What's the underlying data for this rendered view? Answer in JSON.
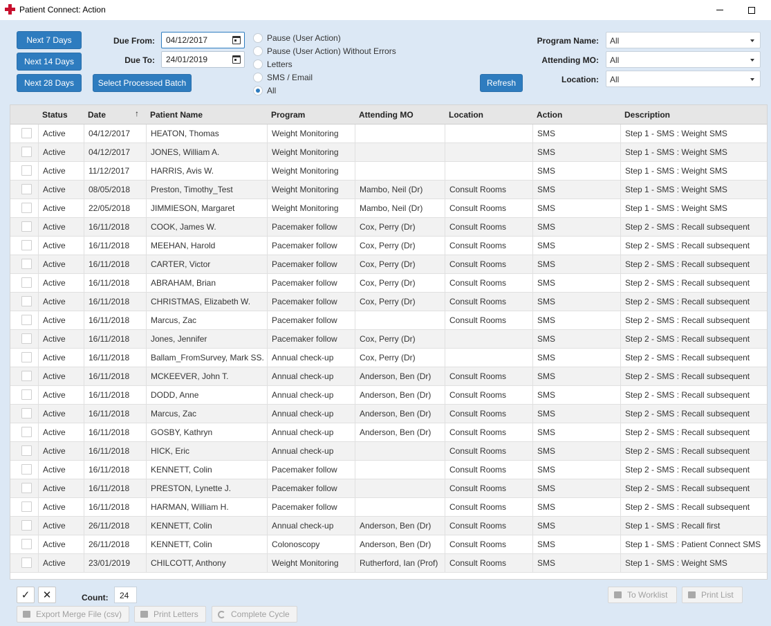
{
  "window": {
    "title": "Patient Connect: Action"
  },
  "buttons": {
    "next7": "Next 7 Days",
    "next14": "Next 14 Days",
    "next28": "Next 28 Days",
    "select_batch": "Select Processed Batch",
    "refresh": "Refresh"
  },
  "filters": {
    "due_from_label": "Due From:",
    "due_from_value": "04/12/2017",
    "due_to_label": "Due To:",
    "due_to_value": "24/01/2019",
    "radio_options": [
      {
        "label": "Pause (User Action)",
        "checked": false
      },
      {
        "label": "Pause (User Action) Without Errors",
        "checked": false
      },
      {
        "label": "Letters",
        "checked": false
      },
      {
        "label": "SMS / Email",
        "checked": false
      },
      {
        "label": "All",
        "checked": true
      }
    ],
    "program_label": "Program Name:",
    "program_value": "All",
    "mo_label": "Attending MO:",
    "mo_value": "All",
    "location_label": "Location:",
    "location_value": "All"
  },
  "table": {
    "columns": [
      "Status",
      "Date",
      "Patient Name",
      "Program",
      "Attending MO",
      "Location",
      "Action",
      "Description"
    ],
    "sort_indicator": "↑",
    "rows": [
      [
        "Active",
        "04/12/2017",
        "HEATON, Thomas",
        "Weight Monitoring",
        "",
        "",
        "SMS",
        "Step 1 - SMS : Weight SMS"
      ],
      [
        "Active",
        "04/12/2017",
        "JONES, William A.",
        "Weight Monitoring",
        "",
        "",
        "SMS",
        "Step 1 - SMS : Weight SMS"
      ],
      [
        "Active",
        "11/12/2017",
        "HARRIS, Avis W.",
        "Weight Monitoring",
        "",
        "",
        "SMS",
        "Step 1 - SMS : Weight SMS"
      ],
      [
        "Active",
        "08/05/2018",
        "Preston, Timothy_Test",
        "Weight Monitoring",
        "Mambo, Neil (Dr)",
        "Consult Rooms",
        "SMS",
        "Step 1 - SMS : Weight SMS"
      ],
      [
        "Active",
        "22/05/2018",
        "JIMMIESON, Margaret",
        "Weight Monitoring",
        "Mambo, Neil (Dr)",
        "Consult Rooms",
        "SMS",
        "Step 1 - SMS : Weight SMS"
      ],
      [
        "Active",
        "16/11/2018",
        "COOK, James W.",
        "Pacemaker follow",
        "Cox, Perry (Dr)",
        "Consult Rooms",
        "SMS",
        "Step 2 - SMS : Recall subsequent"
      ],
      [
        "Active",
        "16/11/2018",
        "MEEHAN, Harold",
        "Pacemaker follow",
        "Cox, Perry (Dr)",
        "Consult Rooms",
        "SMS",
        "Step 2 - SMS : Recall subsequent"
      ],
      [
        "Active",
        "16/11/2018",
        "CARTER, Victor",
        "Pacemaker follow",
        "Cox, Perry (Dr)",
        "Consult Rooms",
        "SMS",
        "Step 2 - SMS : Recall subsequent"
      ],
      [
        "Active",
        "16/11/2018",
        "ABRAHAM, Brian",
        "Pacemaker follow",
        "Cox, Perry (Dr)",
        "Consult Rooms",
        "SMS",
        "Step 2 - SMS : Recall subsequent"
      ],
      [
        "Active",
        "16/11/2018",
        "CHRISTMAS, Elizabeth W.",
        "Pacemaker follow",
        "Cox, Perry (Dr)",
        "Consult Rooms",
        "SMS",
        "Step 2 - SMS : Recall subsequent"
      ],
      [
        "Active",
        "16/11/2018",
        "Marcus, Zac",
        "Pacemaker follow",
        "",
        "Consult Rooms",
        "SMS",
        "Step 2 - SMS : Recall subsequent"
      ],
      [
        "Active",
        "16/11/2018",
        "Jones, Jennifer",
        "Pacemaker follow",
        "Cox, Perry (Dr)",
        "",
        "SMS",
        "Step 2 - SMS : Recall subsequent"
      ],
      [
        "Active",
        "16/11/2018",
        "Ballam_FromSurvey, Mark SS.",
        "Annual check-up",
        "Cox, Perry (Dr)",
        "",
        "SMS",
        "Step 2 - SMS : Recall subsequent"
      ],
      [
        "Active",
        "16/11/2018",
        "MCKEEVER, John T.",
        "Annual check-up",
        "Anderson, Ben (Dr)",
        "Consult Rooms",
        "SMS",
        "Step 2 - SMS : Recall subsequent"
      ],
      [
        "Active",
        "16/11/2018",
        "DODD, Anne",
        "Annual check-up",
        "Anderson, Ben (Dr)",
        "Consult Rooms",
        "SMS",
        "Step 2 - SMS : Recall subsequent"
      ],
      [
        "Active",
        "16/11/2018",
        "Marcus, Zac",
        "Annual check-up",
        "Anderson, Ben (Dr)",
        "Consult Rooms",
        "SMS",
        "Step 2 - SMS : Recall subsequent"
      ],
      [
        "Active",
        "16/11/2018",
        "GOSBY, Kathryn",
        "Annual check-up",
        "Anderson, Ben (Dr)",
        "Consult Rooms",
        "SMS",
        "Step 2 - SMS : Recall subsequent"
      ],
      [
        "Active",
        "16/11/2018",
        "HICK, Eric",
        "Annual check-up",
        "",
        "Consult Rooms",
        "SMS",
        "Step 2 - SMS : Recall subsequent"
      ],
      [
        "Active",
        "16/11/2018",
        "KENNETT, Colin",
        "Pacemaker follow",
        "",
        "Consult Rooms",
        "SMS",
        "Step 2 - SMS : Recall subsequent"
      ],
      [
        "Active",
        "16/11/2018",
        "PRESTON, Lynette J.",
        "Pacemaker follow",
        "",
        "Consult Rooms",
        "SMS",
        "Step 2 - SMS : Recall subsequent"
      ],
      [
        "Active",
        "16/11/2018",
        "HARMAN, William H.",
        "Pacemaker follow",
        "",
        "Consult Rooms",
        "SMS",
        "Step 2 - SMS : Recall subsequent"
      ],
      [
        "Active",
        "26/11/2018",
        "KENNETT, Colin",
        "Annual check-up",
        "Anderson, Ben (Dr)",
        "Consult Rooms",
        "SMS",
        "Step 1 - SMS : Recall first"
      ],
      [
        "Active",
        "26/11/2018",
        "KENNETT, Colin",
        "Colonoscopy",
        "Anderson, Ben (Dr)",
        "Consult Rooms",
        "SMS",
        "Step 1 - SMS : Patient Connect SMS"
      ],
      [
        "Active",
        "23/01/2019",
        "CHILCOTT, Anthony",
        "Weight Monitoring",
        "Rutherford, Ian (Prof)",
        "Consult Rooms",
        "SMS",
        "Step 1 - SMS : Weight SMS"
      ]
    ]
  },
  "footer": {
    "check_glyph": "✓",
    "cross_glyph": "✕",
    "count_label": "Count:",
    "count_value": "24",
    "to_worklist": "To Worklist",
    "print_list": "Print List",
    "export_merge": "Export Merge File (csv)",
    "print_letters": "Print Letters",
    "complete_cycle": "Complete Cycle"
  },
  "colors": {
    "accent": "#2e7cbf",
    "background": "#dce8f5",
    "brand_cross": "#c8102e"
  }
}
